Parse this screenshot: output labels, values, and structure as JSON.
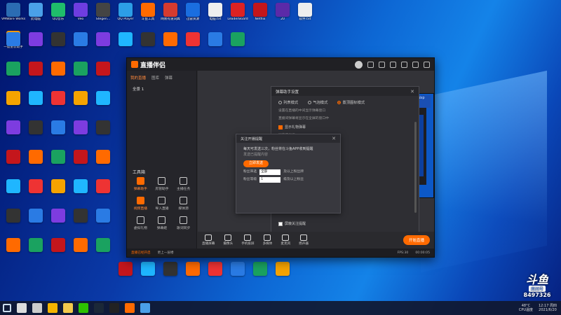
{
  "desktop": {
    "icons": [
      {
        "label": "VMWare Workst...",
        "color": "#2b6cb3"
      },
      {
        "label": "此电脑",
        "color": "#4aa0e8"
      },
      {
        "label": "QQ音乐",
        "color": "#1fbc6b"
      },
      {
        "label": "Veo",
        "color": "#6e3de0"
      },
      {
        "label": "Stegen...",
        "color": "#444"
      },
      {
        "label": "QQ Player",
        "color": "#2c9ee6"
      },
      {
        "label": "斗鱼工具",
        "color": "#ff6a00"
      },
      {
        "label": "网易有道词典",
        "color": "#d63b2f"
      },
      {
        "label": "迅雷资源",
        "color": "#1a6ee0"
      },
      {
        "label": "电脑.txt",
        "color": "#eeeeee"
      },
      {
        "label": "LeaderBoard",
        "color": "#d22"
      },
      {
        "label": "Netflix",
        "color": "#c4161c"
      },
      {
        "label": "20",
        "color": "#5b2aa8"
      },
      {
        "label": "软件.txt",
        "color": "#eee"
      },
      {
        "label": "一键重装助手",
        "color": "#ff9d00"
      }
    ],
    "taskbar_items": [
      "windows-icon",
      "search-icon",
      "task-view-icon",
      "chrome-icon",
      "explorer-icon",
      "wechat-icon",
      "steam-icon",
      "app-21-icon",
      "douyu-icon",
      "monitor-icon"
    ],
    "tray": {
      "temp": "48°C",
      "cpu": "CPU温度",
      "time": "12:17 周四",
      "date": "2021/6/20"
    }
  },
  "douyu": {
    "logo": "斗鱼",
    "room_label": "房间号",
    "room_number": "8497326"
  },
  "app": {
    "title": "直播伴侣",
    "tabs": [
      "我的直播",
      "图库",
      "弹幕"
    ],
    "scene_label": "全景 1",
    "tools_title": "工具箱",
    "tools": [
      {
        "label": "弹幕助手",
        "icon": "chat-icon",
        "orange": true
      },
      {
        "label": "房管助手",
        "icon": "user-icon",
        "orange": false
      },
      {
        "label": "主播任务",
        "icon": "task-icon",
        "orange": false
      },
      {
        "label": "视频直播",
        "icon": "video-icon",
        "orange": true
      },
      {
        "label": "导入直播",
        "icon": "import-icon",
        "orange": false
      },
      {
        "label": "媒体源",
        "icon": "media-icon",
        "orange": false
      },
      {
        "label": "虚拟礼物",
        "icon": "gift-icon",
        "orange": false
      },
      {
        "label": "弹幕姬",
        "icon": "danmu-icon",
        "orange": false
      },
      {
        "label": "歌词同步",
        "icon": "lyric-icon",
        "orange": false
      }
    ],
    "panel": {
      "title": "弹幕助手设置",
      "modes": [
        "列表模式",
        "气泡模式",
        "置顶图标模式"
      ],
      "text1": "设置在直播的中间显示弹幕窗口",
      "text2": "直播间弹幕将显示在全屏的窗口中",
      "check1": "显示礼物弹幕",
      "section": "屏蔽不显示",
      "check2": "屏蔽关注提醒"
    },
    "dialog": {
      "title": "关注开播提醒",
      "line1": "每天可发送三次，粉丝将在斗鱼APP收到提醒",
      "hint": "发送已提醒内容",
      "button": "立即发送",
      "row1_label": "粉丝筛选",
      "row1_select": "全部",
      "row1_after": "及以上粉丝牌",
      "row2_label": "粉丝等级",
      "row2_select": "1",
      "row2_after": "级及以上粉丝"
    },
    "preview_banner": "斗鱼5大直播风 实验WINxp 主播招募",
    "bottom": [
      {
        "label": "直播屏幕",
        "icon": "screen-icon"
      },
      {
        "label": "摄像头",
        "icon": "camera-icon"
      },
      {
        "label": "手机投屏",
        "icon": "phone-icon"
      },
      {
        "label": "多媒体",
        "icon": "media-icon"
      },
      {
        "label": "麦克风",
        "icon": "mic-icon"
      },
      {
        "label": "扬声器",
        "icon": "speaker-icon"
      }
    ],
    "start_button": "开始直播",
    "status": {
      "warn": "直播已经开启",
      "info": "更上一层楼",
      "fps": "FPS:30",
      "time": "00:00:05"
    }
  }
}
